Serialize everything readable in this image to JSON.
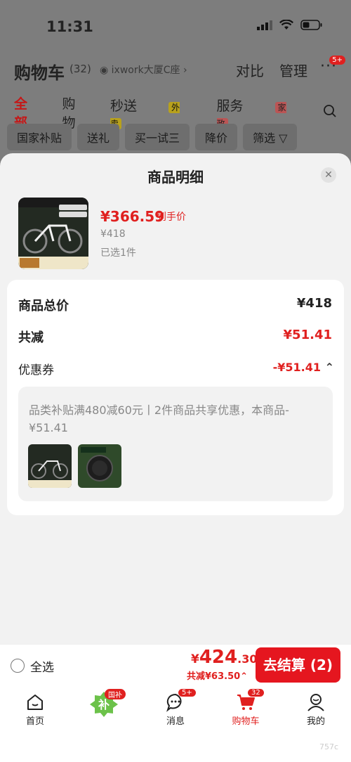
{
  "status": {
    "time": "11:31"
  },
  "header": {
    "title": "购物车",
    "count": "(32)",
    "address": "ixwork大厦C座 ›",
    "compare": "对比",
    "manage": "管理",
    "more_badge": "5+"
  },
  "tabs": [
    {
      "label": "全部"
    },
    {
      "label": "购物"
    },
    {
      "label": "秒送",
      "tag": "外卖"
    },
    {
      "label": "服务",
      "tag": "家政"
    }
  ],
  "filters": [
    "国家补贴",
    "送礼",
    "买一试三",
    "降价",
    "筛选 ▽"
  ],
  "sheet": {
    "title": "商品明细",
    "product": {
      "price": "¥366.59",
      "price_label": "到手价",
      "original": "¥418",
      "selected": "已选1件"
    },
    "summary": {
      "total_label": "商品总价",
      "total_value": "¥418",
      "discount_label": "共减",
      "discount_value": "¥51.41",
      "coupon_label": "优惠券",
      "coupon_value": "-¥51.41"
    },
    "coupon_detail": "品类补贴满480减60元丨2件商品共享优惠，本商品-¥51.41"
  },
  "bottom_bar": {
    "select_all": "全选",
    "currency": "¥",
    "total_int": "424",
    "total_dec": ".30",
    "saved": "共减¥63.50",
    "checkout": "去结算 (2)"
  },
  "nav": [
    {
      "label": "首页",
      "icon": "home-icon"
    },
    {
      "label": "",
      "icon": "subsidy-icon",
      "badge": "国补"
    },
    {
      "label": "消息",
      "icon": "message-icon",
      "badge": "5+"
    },
    {
      "label": "购物车",
      "icon": "cart-icon",
      "badge": "32"
    },
    {
      "label": "我的",
      "icon": "profile-icon"
    }
  ],
  "watermark": "757c",
  "colors": {
    "accent": "#e0201f",
    "button": "#e5161f"
  }
}
